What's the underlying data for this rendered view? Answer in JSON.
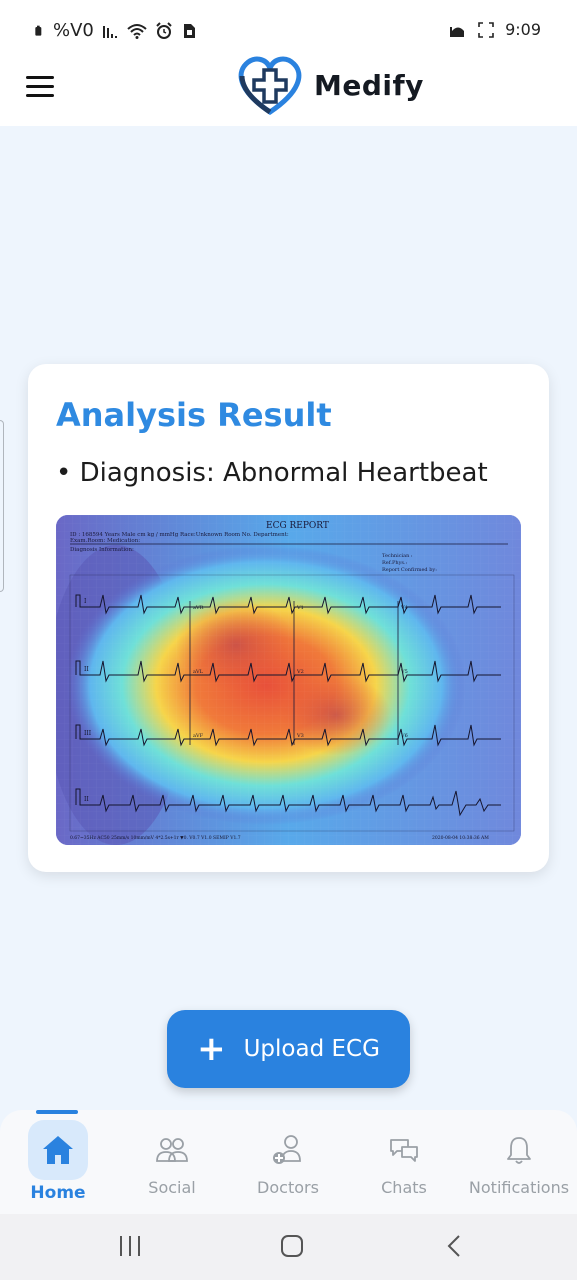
{
  "status_bar": {
    "battery_percent": "%V0",
    "time": "9:09",
    "left_icons": [
      "battery-icon",
      "signal-icon",
      "wifi-icon",
      "alarm-icon",
      "sim-icon"
    ],
    "right_icons": [
      "mosque-icon",
      "screenshot-frame-icon"
    ]
  },
  "app": {
    "title": "Medify",
    "logo": "heart-cross-logo",
    "accent": "#2a82df"
  },
  "analysis": {
    "title": "Analysis Result",
    "diagnosis": "• Diagnosis: Abnormal Heartbeat",
    "image": {
      "report_title": "ECG REPORT",
      "header_line": "ID : 168594     Years   Male        cm        kg       /     mmHg    Race:Unknown    Room  No.     Department:",
      "header_line2": "Exam.Room:    Medication:",
      "diagnosis_info": "Diagnosis Information:",
      "technician": "Technician :",
      "ref_phys": "Ref.Phys.:",
      "confirmed": "Report Confirmed by:",
      "lead_labels": [
        "I",
        "II",
        "III",
        "II"
      ],
      "section_labels": [
        "aVR",
        "aVL",
        "aVF",
        "V1",
        "V2",
        "V3",
        "V4",
        "V5",
        "V6"
      ],
      "footer_left": "0.67~35Hz  AC50  25mm/s  10mm/mV  4*2.5s+1r ▼0.  V0.7 V1.0 SEMIP V1.7",
      "footer_right": "2020-08-04  10:38:36 AM"
    }
  },
  "upload_button": {
    "label": "Upload ECG",
    "icon": "plus-icon"
  },
  "bottom_nav": {
    "active": "Home",
    "items": [
      {
        "label": "Home",
        "icon": "home-icon"
      },
      {
        "label": "Social",
        "icon": "people-icon"
      },
      {
        "label": "Doctors",
        "icon": "doctor-add-icon"
      },
      {
        "label": "Chats",
        "icon": "chat-icon"
      },
      {
        "label": "Notifications",
        "icon": "bell-icon"
      }
    ]
  },
  "system_nav": {
    "icons": [
      "recent-apps-icon",
      "home-circle-icon",
      "back-icon"
    ]
  }
}
